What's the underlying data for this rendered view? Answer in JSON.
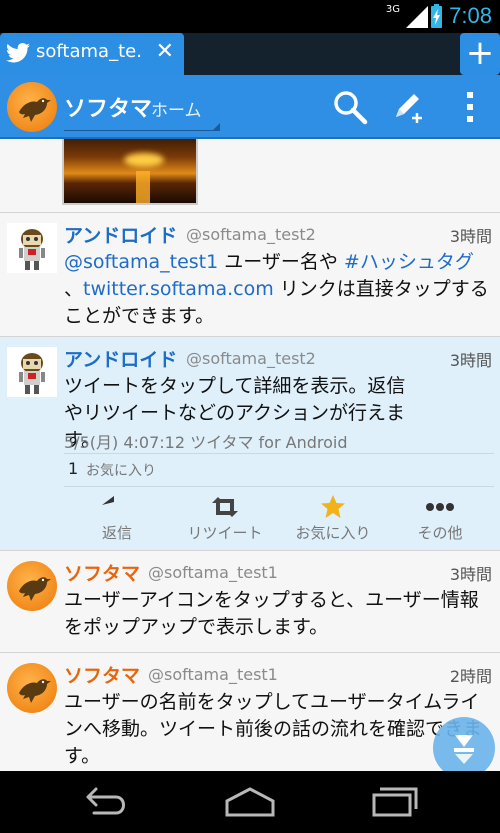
{
  "status_bar": {
    "network": "3G",
    "time": "7:08"
  },
  "tab": {
    "title": "softama_te.",
    "close_glyph": "✕",
    "new_tab_glyph": "+"
  },
  "action_bar": {
    "title": "ソフタマ",
    "subtitle": "ホーム"
  },
  "colors": {
    "accent": "#2e8fe4",
    "link": "#1d6cc7",
    "username_orange": "#e8650c",
    "selected_bg": "#dff0fb"
  },
  "tweets": [
    {
      "name": "アンドロイド",
      "handle": "@softama_test2",
      "ago": "3時間",
      "body_parts": [
        "@softama_test1",
        " ユーザー名や ",
        "#ハッシュタグ",
        "、",
        "twitter.softama.com",
        " リンクは直接タップすることができます。"
      ]
    },
    {
      "name": "アンドロイド",
      "handle": "@softama_test2",
      "ago": "3時間",
      "body": "ツイートをタップして詳細を表示。返信やリツイートなどのアクションが行えます。",
      "meta": "5/5(月) 4:07:12 ツイタマ for Android",
      "fav_count": "1",
      "fav_label": "お気に入り",
      "actions": [
        "返信",
        "リツイート",
        "お気に入り",
        "その他"
      ]
    },
    {
      "name": "ソフタマ",
      "handle": "@softama_test1",
      "ago": "3時間",
      "body": "ユーザーアイコンをタップすると、ユーザー情報をポップアップで表示します。"
    },
    {
      "name": "ソフタマ",
      "handle": "@softama_test1",
      "ago": "2時間",
      "body": "ユーザーの名前をタップしてユーザータイムラインへ移動。ツイート前後の話の流れを確認できます。"
    }
  ],
  "icons": [
    "twitter-bird-icon",
    "search-icon",
    "compose-icon",
    "overflow-menu-icon",
    "reply-icon",
    "retweet-icon",
    "star-icon",
    "more-icon",
    "scroll-down-icon",
    "back-icon",
    "home-icon",
    "recents-icon"
  ]
}
